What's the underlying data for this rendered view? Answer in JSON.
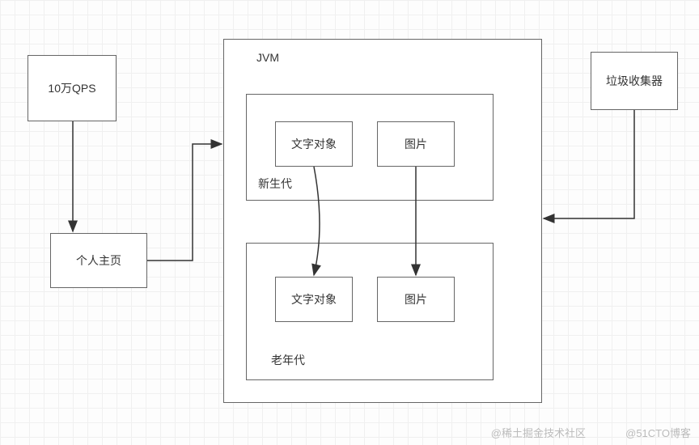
{
  "boxes": {
    "qps": "10万QPS",
    "homepage": "个人主页",
    "gc": "垃圾收集器",
    "jvm": "JVM",
    "young_gen": "新生代",
    "old_gen": "老年代",
    "text_obj_young": "文字对象",
    "image_young": "图片",
    "text_obj_old": "文字对象",
    "image_old": "图片"
  },
  "watermarks": {
    "wm1": "@稀土掘金技术社区",
    "wm2": "@51CTO博客"
  }
}
